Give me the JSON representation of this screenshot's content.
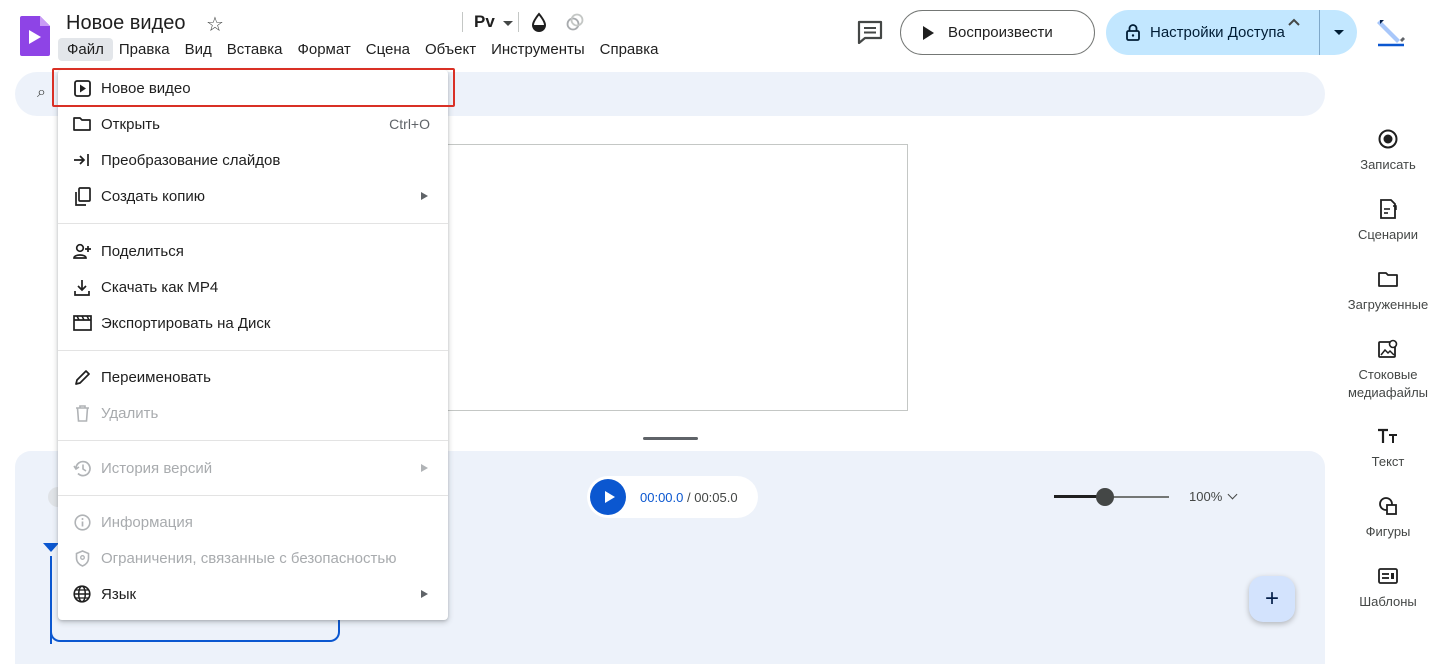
{
  "app": {
    "title": "Новое видео"
  },
  "menubar": {
    "items": [
      "Файл",
      "Правка",
      "Вид",
      "Вставка",
      "Формат",
      "Сцена",
      "Объект",
      "Инструменты",
      "Справка"
    ]
  },
  "header": {
    "play_label": "Воспроизвести",
    "share_label": "Настройки Доступа"
  },
  "toolbar": {
    "font_label": "Pv"
  },
  "file_menu": {
    "items": [
      {
        "label": "Новое видео",
        "icon": "video-play-icon",
        "shortcut": "",
        "submenu": false,
        "disabled": false
      },
      {
        "label": "Открыть",
        "icon": "folder-icon",
        "shortcut": "Ctrl+O",
        "submenu": false,
        "disabled": false
      },
      {
        "label": "Преобразование слайдов",
        "icon": "import-icon",
        "shortcut": "",
        "submenu": false,
        "disabled": false
      },
      {
        "label": "Создать копию",
        "icon": "copy-icon",
        "shortcut": "",
        "submenu": true,
        "disabled": false
      },
      {
        "label": "Поделиться",
        "icon": "person-add-icon",
        "shortcut": "",
        "submenu": false,
        "disabled": false
      },
      {
        "label": "Скачать как MP4",
        "icon": "download-icon",
        "shortcut": "",
        "submenu": false,
        "disabled": false
      },
      {
        "label": "Экспортировать на Диск",
        "icon": "film-icon",
        "shortcut": "",
        "submenu": false,
        "disabled": false
      },
      {
        "label": "Переименовать",
        "icon": "pencil-icon",
        "shortcut": "",
        "submenu": false,
        "disabled": false
      },
      {
        "label": "Удалить",
        "icon": "trash-icon",
        "shortcut": "",
        "submenu": false,
        "disabled": true
      },
      {
        "label": "История версий",
        "icon": "history-icon",
        "shortcut": "",
        "submenu": true,
        "disabled": true
      },
      {
        "label": "Информация",
        "icon": "info-icon",
        "shortcut": "",
        "submenu": false,
        "disabled": true
      },
      {
        "label": "Ограничения, связанные с безопасностью",
        "icon": "shield-icon",
        "shortcut": "",
        "submenu": false,
        "disabled": true
      },
      {
        "label": "Язык",
        "icon": "globe-icon",
        "shortcut": "",
        "submenu": true,
        "disabled": false
      }
    ]
  },
  "player": {
    "current_time": "00:00.0",
    "separator": " / ",
    "total_time": "00:05.0"
  },
  "zoom": {
    "level_label": "100%",
    "slider_fraction": 0.44
  },
  "side_panel": {
    "items": [
      {
        "label": "Записать",
        "icon": "record-icon"
      },
      {
        "label": "Сценарии",
        "icon": "script-icon"
      },
      {
        "label": "Загруженные",
        "icon": "folder-icon"
      },
      {
        "label": "Стоковые медиафайлы",
        "icon": "stock-image-icon"
      },
      {
        "label": "Текст",
        "icon": "text-icon"
      },
      {
        "label": "Фигуры",
        "icon": "shapes-icon"
      },
      {
        "label": "Шаблоны",
        "icon": "templates-icon"
      }
    ]
  },
  "colors": {
    "accent": "#0b57d0",
    "share_bg": "#c2e7ff",
    "highlight": "#d93025",
    "panel_bg": "#edf2fa"
  }
}
